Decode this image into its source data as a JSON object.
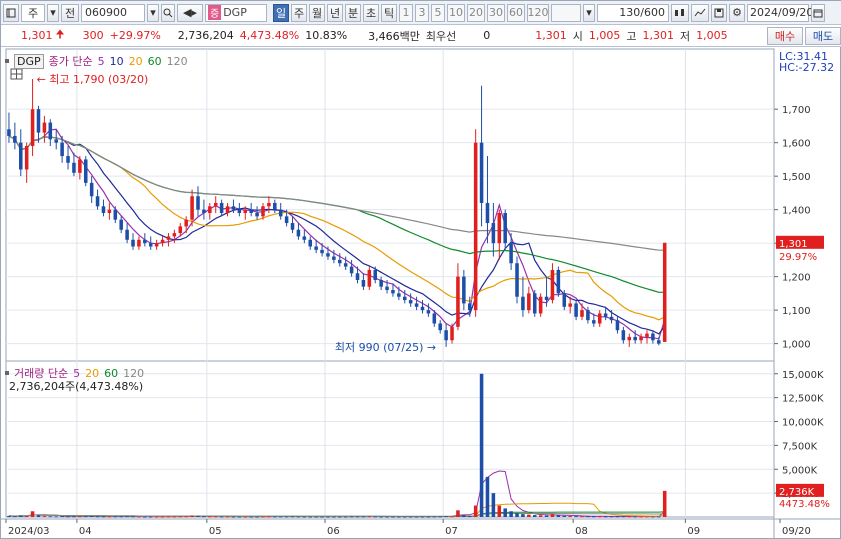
{
  "toolbar": {
    "market": "주",
    "prev_label": "전",
    "code": "060900",
    "name": "DGP",
    "name_badge": "증",
    "periods": [
      "일",
      "주",
      "월",
      "년",
      "분",
      "초",
      "틱"
    ],
    "active_period": "일",
    "intervals": [
      "1",
      "3",
      "5",
      "10",
      "20",
      "30",
      "60",
      "120"
    ],
    "count": "130/600",
    "date": "2024/09/20"
  },
  "quote": {
    "price": "1,301",
    "change": "300",
    "change_pct": "+29.97%",
    "volume": "2,736,204",
    "volume_ratio": "4,473.48%",
    "turnover": "10.83%",
    "amount": "3,466백만",
    "preferred_label": "최우선",
    "preferred_value": "0",
    "last": "1,301",
    "open_label": "시",
    "open": "1,005",
    "high_label": "고",
    "high": "1,301",
    "low_label": "저",
    "low": "1,005",
    "buy_label": "매수",
    "sell_label": "매도"
  },
  "price_panel": {
    "code_tag": "DGP",
    "legend_title": "종가 단순",
    "ma_periods": [
      "5",
      "10",
      "20",
      "60",
      "120"
    ],
    "ma_colors": [
      "#9b2fae",
      "#1f2a9a",
      "#e89b00",
      "#0f8a2a",
      "#888888"
    ],
    "lc": "LC:31.41",
    "hc": "HC:-27.32",
    "high_note": "최고 1,790 (03/20)",
    "low_note": "최저 990 (07/25)",
    "current_price": "1,301",
    "current_pct": "29.97%"
  },
  "volume_panel": {
    "legend_title": "거래량 단순",
    "ma_periods": [
      "5",
      "20",
      "60",
      "120"
    ],
    "ma_colors": [
      "#9b2fae",
      "#e89b00",
      "#0f8a2a",
      "#888888"
    ],
    "summary": "2,736,204주(4,473.48%)",
    "current_volume": "2,736K",
    "current_pct": "4473.48%"
  },
  "chart_data": {
    "type": "candlestick",
    "price_axis": {
      "min": 960,
      "max": 1820,
      "ticks": [
        1000,
        1100,
        1200,
        1300,
        1400,
        1500,
        1600,
        1700
      ]
    },
    "price_tick_labels": [
      "1,000",
      "1,100",
      "1,200",
      "1,300",
      "1,400",
      "1,500",
      "1,600",
      "1,700"
    ],
    "volume_axis": {
      "min": 0,
      "max": 15500,
      "ticks": [
        2500,
        5000,
        7500,
        10000,
        12500,
        15000
      ]
    },
    "volume_tick_labels": [
      "2,500K",
      "5,000K",
      "7,500K",
      "10,000K",
      "12,500K",
      "15,000K"
    ],
    "month_labels": [
      "2024/03",
      "04",
      "05",
      "06",
      "07",
      "08",
      "09",
      "09/20"
    ],
    "month_start_index": [
      0,
      12,
      34,
      54,
      74,
      96,
      115,
      130
    ],
    "candles": [
      [
        1640,
        1690,
        1600,
        1620,
        120
      ],
      [
        1620,
        1660,
        1580,
        1600,
        90
      ],
      [
        1600,
        1640,
        1500,
        1520,
        150
      ],
      [
        1520,
        1600,
        1480,
        1590,
        110
      ],
      [
        1590,
        1790,
        1560,
        1700,
        600
      ],
      [
        1700,
        1710,
        1600,
        1630,
        180
      ],
      [
        1630,
        1680,
        1600,
        1660,
        90
      ],
      [
        1660,
        1670,
        1590,
        1610,
        80
      ],
      [
        1610,
        1640,
        1580,
        1600,
        70
      ],
      [
        1600,
        1620,
        1540,
        1560,
        90
      ],
      [
        1560,
        1590,
        1520,
        1540,
        60
      ],
      [
        1540,
        1570,
        1500,
        1510,
        70
      ],
      [
        1510,
        1560,
        1490,
        1550,
        80
      ],
      [
        1550,
        1560,
        1470,
        1480,
        90
      ],
      [
        1480,
        1500,
        1420,
        1440,
        100
      ],
      [
        1440,
        1460,
        1400,
        1410,
        70
      ],
      [
        1410,
        1430,
        1380,
        1390,
        60
      ],
      [
        1390,
        1420,
        1370,
        1400,
        50
      ],
      [
        1400,
        1410,
        1360,
        1370,
        60
      ],
      [
        1370,
        1380,
        1330,
        1340,
        70
      ],
      [
        1340,
        1360,
        1300,
        1310,
        80
      ],
      [
        1310,
        1330,
        1280,
        1290,
        60
      ],
      [
        1290,
        1320,
        1280,
        1310,
        50
      ],
      [
        1310,
        1330,
        1290,
        1300,
        40
      ],
      [
        1300,
        1320,
        1280,
        1290,
        40
      ],
      [
        1290,
        1310,
        1280,
        1300,
        40
      ],
      [
        1300,
        1320,
        1290,
        1310,
        40
      ],
      [
        1310,
        1330,
        1290,
        1320,
        50
      ],
      [
        1320,
        1340,
        1300,
        1330,
        50
      ],
      [
        1330,
        1360,
        1320,
        1350,
        60
      ],
      [
        1350,
        1380,
        1330,
        1370,
        70
      ],
      [
        1370,
        1460,
        1350,
        1440,
        150
      ],
      [
        1440,
        1470,
        1380,
        1400,
        120
      ],
      [
        1400,
        1430,
        1370,
        1390,
        80
      ],
      [
        1390,
        1420,
        1370,
        1410,
        60
      ],
      [
        1410,
        1440,
        1390,
        1420,
        60
      ],
      [
        1420,
        1430,
        1380,
        1390,
        50
      ],
      [
        1390,
        1420,
        1380,
        1410,
        50
      ],
      [
        1410,
        1430,
        1390,
        1400,
        40
      ],
      [
        1400,
        1420,
        1380,
        1390,
        40
      ],
      [
        1390,
        1410,
        1370,
        1400,
        40
      ],
      [
        1400,
        1420,
        1380,
        1390,
        40
      ],
      [
        1390,
        1410,
        1370,
        1380,
        40
      ],
      [
        1380,
        1420,
        1370,
        1410,
        50
      ],
      [
        1410,
        1440,
        1390,
        1420,
        60
      ],
      [
        1420,
        1430,
        1390,
        1400,
        50
      ],
      [
        1400,
        1420,
        1370,
        1380,
        50
      ],
      [
        1380,
        1400,
        1350,
        1360,
        50
      ],
      [
        1360,
        1380,
        1330,
        1340,
        60
      ],
      [
        1340,
        1360,
        1310,
        1320,
        50
      ],
      [
        1320,
        1340,
        1300,
        1310,
        40
      ],
      [
        1310,
        1320,
        1280,
        1290,
        40
      ],
      [
        1290,
        1310,
        1270,
        1280,
        40
      ],
      [
        1280,
        1300,
        1260,
        1270,
        40
      ],
      [
        1270,
        1290,
        1250,
        1260,
        40
      ],
      [
        1260,
        1280,
        1240,
        1250,
        40
      ],
      [
        1250,
        1270,
        1230,
        1240,
        40
      ],
      [
        1240,
        1260,
        1220,
        1230,
        40
      ],
      [
        1230,
        1250,
        1200,
        1210,
        50
      ],
      [
        1210,
        1230,
        1180,
        1190,
        50
      ],
      [
        1190,
        1210,
        1160,
        1170,
        50
      ],
      [
        1170,
        1230,
        1160,
        1220,
        70
      ],
      [
        1220,
        1230,
        1180,
        1190,
        50
      ],
      [
        1190,
        1200,
        1160,
        1170,
        40
      ],
      [
        1170,
        1190,
        1150,
        1160,
        40
      ],
      [
        1160,
        1180,
        1140,
        1150,
        40
      ],
      [
        1150,
        1170,
        1130,
        1140,
        40
      ],
      [
        1140,
        1160,
        1120,
        1130,
        40
      ],
      [
        1130,
        1150,
        1110,
        1120,
        40
      ],
      [
        1120,
        1140,
        1100,
        1110,
        40
      ],
      [
        1110,
        1130,
        1090,
        1100,
        40
      ],
      [
        1100,
        1120,
        1080,
        1090,
        40
      ],
      [
        1090,
        1100,
        1050,
        1060,
        50
      ],
      [
        1060,
        1070,
        1030,
        1040,
        60
      ],
      [
        1040,
        1060,
        990,
        1010,
        90
      ],
      [
        1010,
        1060,
        1000,
        1050,
        70
      ],
      [
        1050,
        1240,
        1040,
        1200,
        700
      ],
      [
        1200,
        1220,
        1100,
        1120,
        200
      ],
      [
        1120,
        1140,
        1080,
        1100,
        100
      ],
      [
        1100,
        1640,
        1080,
        1600,
        1200
      ],
      [
        1600,
        1770,
        1350,
        1420,
        15000
      ],
      [
        1420,
        1560,
        1300,
        1360,
        4200
      ],
      [
        1360,
        1420,
        1260,
        1300,
        2500
      ],
      [
        1300,
        1400,
        1250,
        1390,
        1200
      ],
      [
        1390,
        1400,
        1280,
        1300,
        900
      ],
      [
        1300,
        1330,
        1220,
        1240,
        600
      ],
      [
        1240,
        1260,
        1120,
        1140,
        400
      ],
      [
        1140,
        1200,
        1080,
        1100,
        300
      ],
      [
        1100,
        1170,
        1090,
        1150,
        250
      ],
      [
        1150,
        1160,
        1080,
        1090,
        200
      ],
      [
        1090,
        1150,
        1080,
        1140,
        180
      ],
      [
        1140,
        1200,
        1110,
        1130,
        150
      ],
      [
        1130,
        1240,
        1120,
        1220,
        300
      ],
      [
        1220,
        1230,
        1140,
        1150,
        180
      ],
      [
        1150,
        1160,
        1100,
        1110,
        120
      ],
      [
        1110,
        1140,
        1090,
        1120,
        100
      ],
      [
        1120,
        1130,
        1070,
        1080,
        90
      ],
      [
        1080,
        1120,
        1070,
        1100,
        80
      ],
      [
        1100,
        1110,
        1060,
        1070,
        80
      ],
      [
        1070,
        1090,
        1050,
        1060,
        70
      ],
      [
        1060,
        1100,
        1050,
        1090,
        70
      ],
      [
        1090,
        1110,
        1070,
        1080,
        60
      ],
      [
        1080,
        1100,
        1060,
        1070,
        60
      ],
      [
        1070,
        1080,
        1030,
        1040,
        60
      ],
      [
        1040,
        1050,
        1000,
        1010,
        70
      ],
      [
        1010,
        1030,
        990,
        1020,
        60
      ],
      [
        1020,
        1040,
        1000,
        1010,
        50
      ],
      [
        1010,
        1030,
        1000,
        1020,
        50
      ],
      [
        1020,
        1040,
        1000,
        1030,
        50
      ],
      [
        1030,
        1040,
        1000,
        1010,
        50
      ],
      [
        1010,
        1020,
        995,
        1000,
        60
      ],
      [
        1005,
        1301,
        1005,
        1301,
        2736
      ]
    ]
  }
}
